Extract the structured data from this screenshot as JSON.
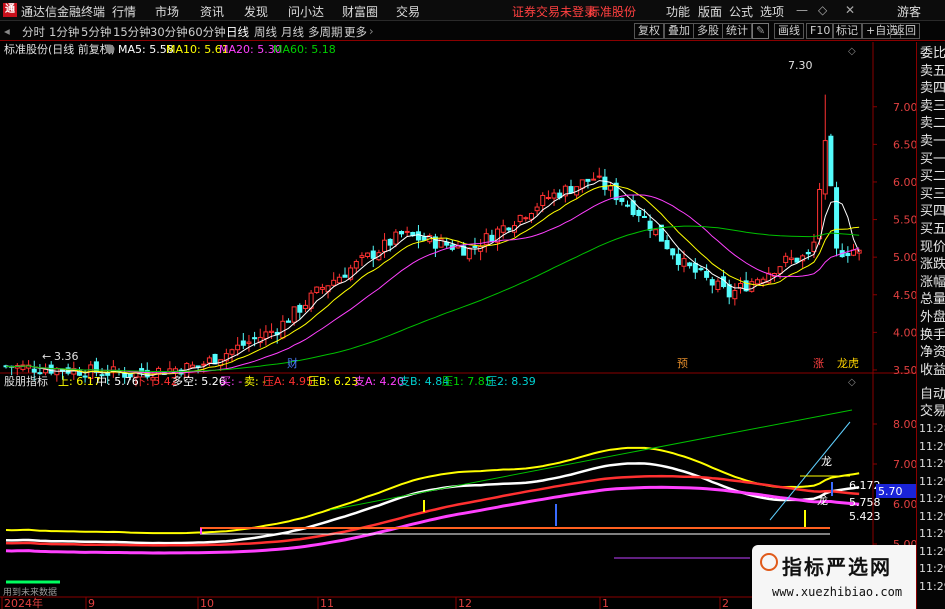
{
  "app": {
    "logo": "通",
    "title": "通达信金融终端"
  },
  "menu": {
    "items": [
      "行情",
      "市场",
      "资讯",
      "发现",
      "问小达",
      "财富圈",
      "交易"
    ],
    "status": "证券交易未登录",
    "stock_link": "标准股份",
    "right_items": [
      "功能",
      "版面",
      "公式",
      "选项"
    ],
    "guest": "游客"
  },
  "timeframes": {
    "items": [
      "分时",
      "1分钟",
      "5分钟",
      "15分钟",
      "30分钟",
      "60分钟",
      "日线",
      "周线",
      "月线",
      "多周期",
      "更多"
    ],
    "active": "日线"
  },
  "toolbar": {
    "buttons": [
      "复权",
      "叠加",
      "多股",
      "统计",
      "画线",
      "F10",
      "标记",
      "+自选",
      "返回"
    ]
  },
  "right_panel": {
    "items": [
      "委比",
      "卖五",
      "卖四",
      "卖三",
      "卖二",
      "卖一",
      "买一",
      "买二",
      "买三",
      "买四",
      "买五",
      "现价",
      "涨跌",
      "涨幅",
      "总量",
      "外盘",
      "换手",
      "净资",
      "收益"
    ],
    "bottom": [
      "自动",
      "交易"
    ],
    "times": [
      "11:28",
      "11:29",
      "11:29",
      "11:29",
      "11:29",
      "11:29",
      "11:29",
      "11:29",
      "11:29",
      "11:29"
    ]
  },
  "colors": {
    "up": "#ff3232",
    "down": "#54fcfc",
    "ma5": "#ffffff",
    "ma10": "#ffff00",
    "ma20": "#ff40ff",
    "ma60": "#00c000",
    "upper": "#ffff00",
    "mid": "#ffffff",
    "low": "#ff3030",
    "support": "#ff40ff"
  },
  "main_chart": {
    "header": {
      "name": "标准股份(日线 前复权)",
      "ma5": "MA5: 5.58",
      "ma10": "MA10: 5.61",
      "ma20": "MA20: 5.30",
      "ma60": "MA60: 5.18"
    },
    "y_axis": [
      "7.00",
      "6.50",
      "6.00",
      "5.50",
      "5.00",
      "4.50",
      "4.00",
      "3.50"
    ],
    "y_values": [
      7.0,
      6.5,
      6.0,
      5.5,
      5.0,
      4.5,
      4.0,
      3.5
    ],
    "high_label": "7.30",
    "low_label": "3.36",
    "markers": {
      "cai": "财",
      "yu": "预",
      "zhang": "涨",
      "lhb": "龙虎"
    }
  },
  "sub_chart": {
    "header": {
      "name": "股朋指标",
      "up": "上: 6.17",
      "mid": "中: 5.76",
      "down": "下: 5.42",
      "duokong": "多空: 5.26",
      "buy": "买: -",
      "sell": "卖: -",
      "ya_a": "压A: 4.95",
      "ya_b": "压B: 6.23",
      "zhi_a": "支A: 4.20",
      "zhi_b": "支B: 4.84",
      "ya1": "压1: 7.85",
      "ya2": "压2: 8.39"
    },
    "y_axis": [
      "8.00",
      "7.00",
      "6.00",
      "5.00"
    ],
    "y_values": [
      8.0,
      7.0,
      6.0,
      5.0
    ],
    "value_labels": [
      "6.172",
      "5.758",
      "5.423"
    ],
    "price_tag": "5.70",
    "long_labels": [
      "龙",
      "龙"
    ],
    "footer": "用到未来数据"
  },
  "x_axis": [
    "2024年",
    "9",
    "10",
    "11",
    "12",
    "1",
    "2"
  ],
  "watermark": {
    "title": "指标严选网",
    "url": "www.xuezhibiao.com"
  }
}
